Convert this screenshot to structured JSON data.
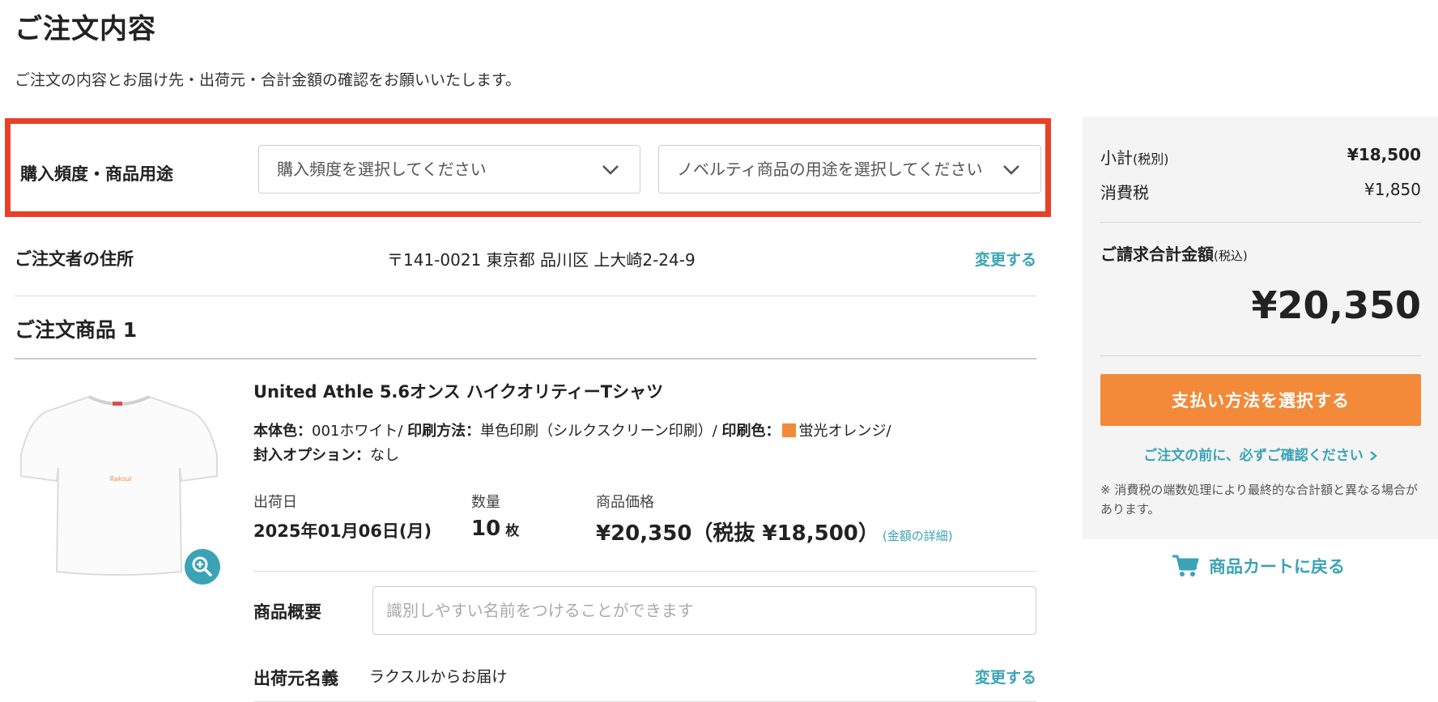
{
  "page": {
    "title": "ご注文内容",
    "description": "ご注文の内容とお届け先・出荷元・合計金額の確認をお願いいたします。"
  },
  "usage": {
    "label": "購入頻度・商品用途",
    "frequency_select": "購入頻度を選択してください",
    "purpose_select": "ノベルティ商品の用途を選択してください"
  },
  "address": {
    "label": "ご注文者の住所",
    "value": "〒141-0021 東京都 品川区 上大崎2-24-9",
    "change_label": "変更する"
  },
  "product": {
    "heading": "ご注文商品 1",
    "name": "United Athle 5.6オンス ハイクオリティーTシャツ",
    "print_text": "Raksul",
    "spec": {
      "body_color_label": "本体色：",
      "body_color_value": "001ホワイト/",
      "print_method_label": "印刷方法：",
      "print_method_value": "単色印刷（シルクスクリーン印刷）/",
      "print_color_label": "印刷色：",
      "print_color_value": "蛍光オレンジ/",
      "print_color_hex": "#f28a3a",
      "enclosure_label": "封入オプション：",
      "enclosure_value": "なし"
    },
    "ship_date_label": "出荷日",
    "ship_date": "2025年01月06日(月)",
    "qty_label": "数量",
    "qty": "10",
    "qty_unit": "枚",
    "price_label": "商品価格",
    "price": "¥20,350（税抜 ¥18,500）",
    "price_detail": "(金額の詳細)",
    "summary_label": "商品概要",
    "summary_placeholder": "識別しやすい名前をつけることができます",
    "sender_label": "出荷元名義",
    "sender_value": "ラクスルからお届け",
    "sender_change": "変更する"
  },
  "side": {
    "subtotal_label": "小計",
    "subtotal_note": "(税別)",
    "subtotal": "¥18,500",
    "tax_label": "消費税",
    "tax": "¥1,850",
    "total_label": "ご請求合計金額",
    "total_note": "(税込)",
    "total": "¥20,350",
    "pay_button": "支払い方法を選択する",
    "confirm_link": "ご注文の前に、必ずご確認ください",
    "note": "※ 消費税の端数処理により最終的な合計額と異なる場合があります。",
    "cart_link": "商品カートに戻る"
  },
  "colors": {
    "accent_teal": "#3aa3b6",
    "cta_orange": "#f28a3a",
    "highlight_red": "#e8402a"
  }
}
